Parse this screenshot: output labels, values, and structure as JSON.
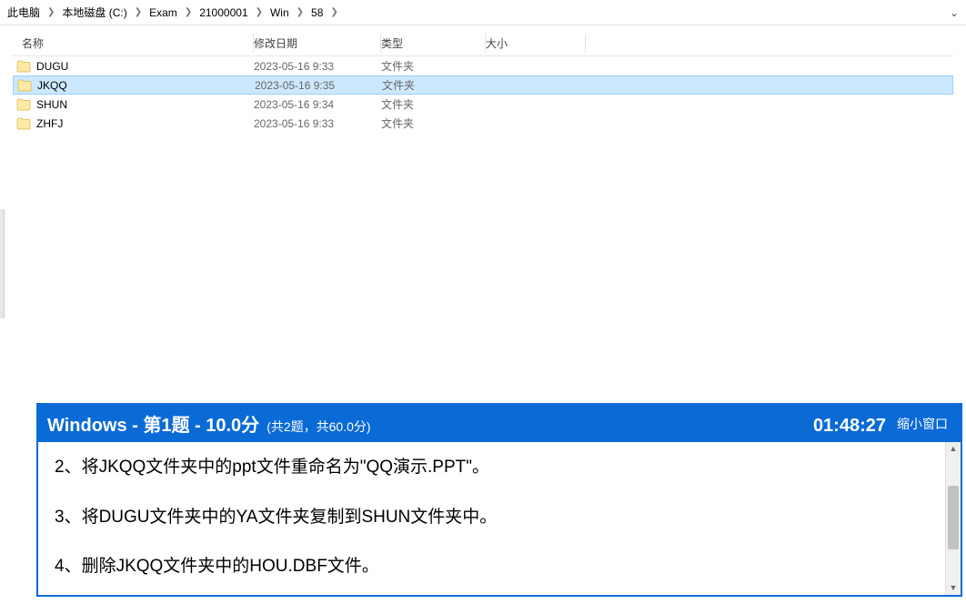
{
  "breadcrumb": {
    "items": [
      {
        "label": "此电脑"
      },
      {
        "label": "本地磁盘 (C:)"
      },
      {
        "label": "Exam"
      },
      {
        "label": "21000001"
      },
      {
        "label": "Win"
      },
      {
        "label": "58"
      }
    ]
  },
  "columns": {
    "name": "名称",
    "date": "修改日期",
    "type": "类型",
    "size": "大小"
  },
  "rows": [
    {
      "name": "DUGU",
      "date": "2023-05-16 9:33",
      "type": "文件夹",
      "selected": false
    },
    {
      "name": "JKQQ",
      "date": "2023-05-16 9:35",
      "type": "文件夹",
      "selected": true
    },
    {
      "name": "SHUN",
      "date": "2023-05-16 9:34",
      "type": "文件夹",
      "selected": false
    },
    {
      "name": "ZHFJ",
      "date": "2023-05-16 9:33",
      "type": "文件夹",
      "selected": false
    }
  ],
  "exam": {
    "title_main": "Windows - 第1题 - 10.0分",
    "title_sub": "(共2题，共60.0分)",
    "timer": "01:48:27",
    "collapse_label": "缩小窗口",
    "tasks": [
      "2、将JKQQ文件夹中的ppt文件重命名为\"QQ演示.PPT\"。",
      "3、将DUGU文件夹中的YA文件夹复制到SHUN文件夹中。",
      "4、删除JKQQ文件夹中的HOU.DBF文件。"
    ]
  }
}
